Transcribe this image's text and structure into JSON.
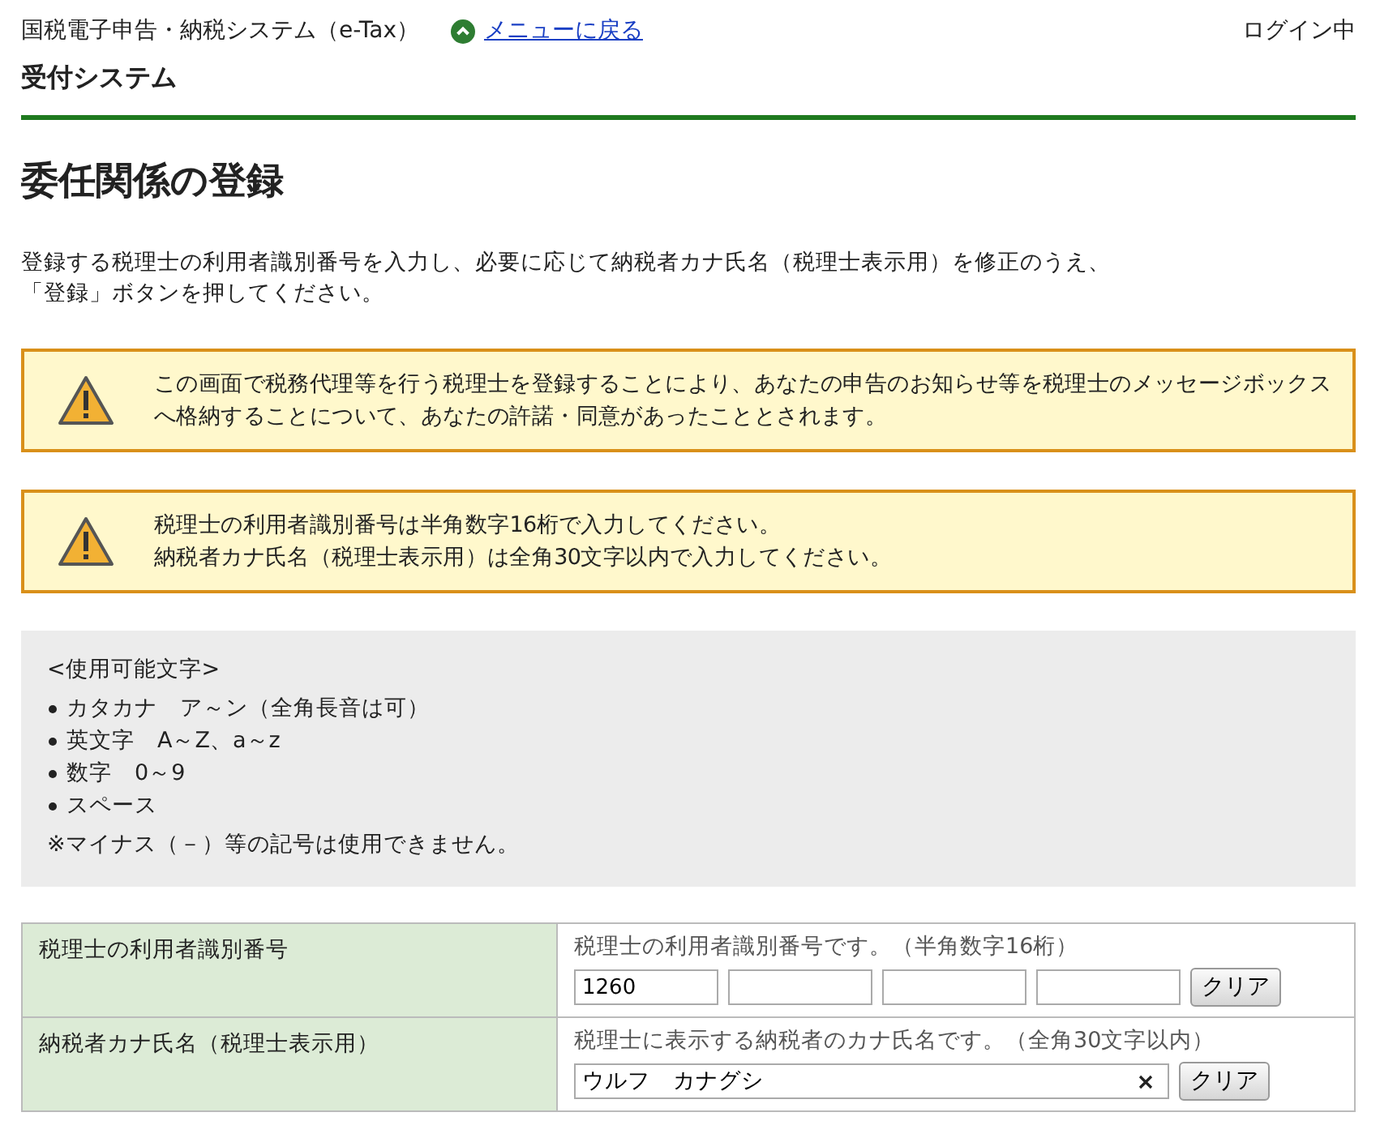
{
  "header": {
    "system_name": "国税電子申告・納税システム（e-Tax）",
    "back_link": "メニューに戻る",
    "login_status": "ログイン中"
  },
  "subtitle": "受付システム",
  "page_title": "委任関係の登録",
  "instructions": [
    "登録する税理士の利用者識別番号を入力し、必要に応じて納税者カナ氏名（税理士表示用）を修正のうえ、",
    "「登録」ボタンを押してください。"
  ],
  "notices": [
    {
      "lines": [
        "この画面で税務代理等を行う税理士を登録することにより、あなたの申告のお知らせ等を税理士のメッセージボックス",
        "へ格納することについて、あなたの許諾・同意があったこととされます。"
      ]
    },
    {
      "lines": [
        "税理士の利用者識別番号は半角数字16桁で入力してください。",
        "納税者カナ氏名（税理士表示用）は全角30文字以内で入力してください。"
      ]
    }
  ],
  "allowed_chars": {
    "heading": "<使用可能文字>",
    "items": [
      "カタカナ　ア～ン（全角長音は可）",
      "英文字　A～Z、a～z",
      "数字　0～9",
      "スペース"
    ],
    "note": "※マイナス（－）等の記号は使用できません。"
  },
  "form_rows": [
    {
      "kind": "segmented",
      "label": "税理士の利用者識別番号",
      "hint": "税理士の利用者識別番号です。（半角数字16桁）",
      "segments": [
        {
          "kind": "filled",
          "value": "1260"
        },
        {
          "kind": "blank"
        },
        {
          "kind": "blank"
        },
        {
          "kind": "blank"
        }
      ],
      "clear_button": "クリア"
    },
    {
      "kind": "text",
      "label": "納税者カナ氏名（税理士表示用）",
      "hint": "税理士に表示する納税者のカナ氏名です。（全角30文字以内）",
      "value": "ウルフ　カナグシ",
      "clear_icon": true,
      "clear_button": "クリア"
    }
  ]
}
